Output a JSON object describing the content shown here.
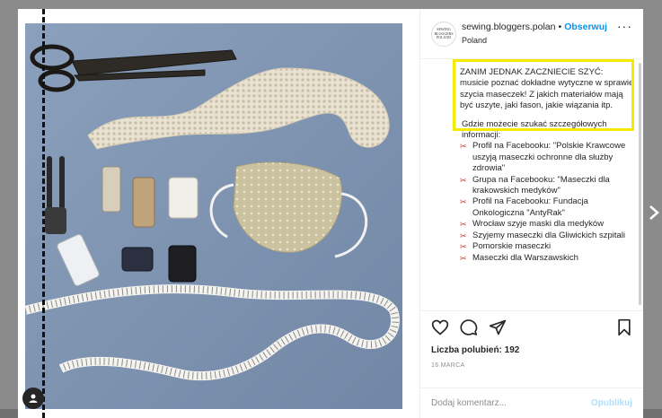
{
  "post": {
    "username": "sewing.bloggers.polan",
    "dot": "•",
    "follow_label": "Obserwuj",
    "location": "Poland",
    "avatar_text": "SEWING BLOGGERS POLAND"
  },
  "caption": {
    "highlight": "ZANIM JEDNAK ZACZNIECIE SZYĆ: musicie poznać dokładne wytyczne w sprawie szycia maseczek! Z jakich materiałów mają być uszyte, jaki fason, jakie wiązania itp.",
    "intro": "Gdzie możecie szukać szczegółowych informacji:",
    "items": [
      "Profil na Facebooku: \"Polskie Krawcowe uszyją maseczki ochronne dla służby zdrowia\"",
      "Grupa na Facebooku: \"Maseczki dla krakowskich medyków\"",
      "Profil na Facebooku: Fundacja Onkologiczna \"AntyRak\"",
      "Wrocław szyje maski dla medyków",
      "Szyjemy maseczki dla Gliwickich szpitali",
      "Pomorskie maseczki",
      "Maseczki dla Warszawskich"
    ],
    "bullet_glyph": "✂",
    "bullet_color": "#c0392b"
  },
  "actions": {
    "likes": "Liczba polubień: 192",
    "date": "16 MARCA"
  },
  "comment": {
    "placeholder": "Dodaj komentarz...",
    "publish_label": "Opublikuj"
  },
  "icons": {
    "like": "heart-icon",
    "comment": "comment-icon",
    "share": "share-icon",
    "save": "bookmark-icon",
    "more": "more-icon",
    "next": "chevron-right-icon",
    "user_tag": "user-tag-icon"
  },
  "colors": {
    "accent": "#0095f6",
    "highlight_border": "#f5ea00",
    "photo_background": "#7f95b2"
  }
}
